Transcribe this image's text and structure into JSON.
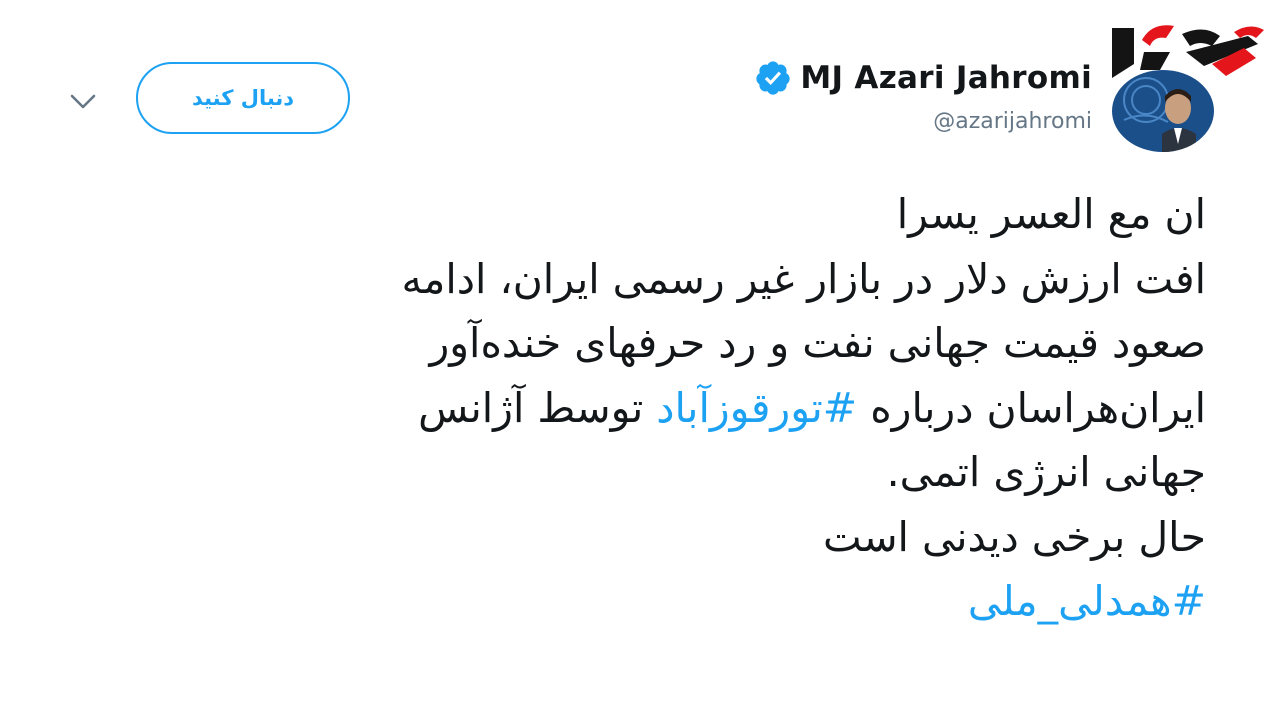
{
  "header": {
    "follow_label": "دنبال کنید",
    "chevron_icon": "chevron-down-icon"
  },
  "author": {
    "name": "MJ Azari Jahromi",
    "handle": "@azarijahromi",
    "verified_icon": "verified-badge-icon",
    "avatar": "user-avatar"
  },
  "watermark": {
    "logo_icon": "rokna-logo",
    "colors": {
      "red": "#e4161c",
      "black": "#141414"
    }
  },
  "tweet": {
    "line1": "ان مع العسر یسرا",
    "line2": "افت ارزش دلار در بازار غیر رسمی ایران، ادامه",
    "line3": "صعود قیمت جهانی نفت و رد حرفهای خنده‌آور",
    "line4_before": "ایران‌هراسان درباره ",
    "hashtag1": "#تورقوزآباد",
    "line4_after": " توسط آژانس",
    "line5": "جهانی انرژی اتمی.",
    "line6": "حال برخی دیدنی است",
    "hashtag2": "#همدلی_ملی"
  },
  "colors": {
    "accent": "#1da1f2",
    "text": "#14171a",
    "muted": "#657786"
  }
}
